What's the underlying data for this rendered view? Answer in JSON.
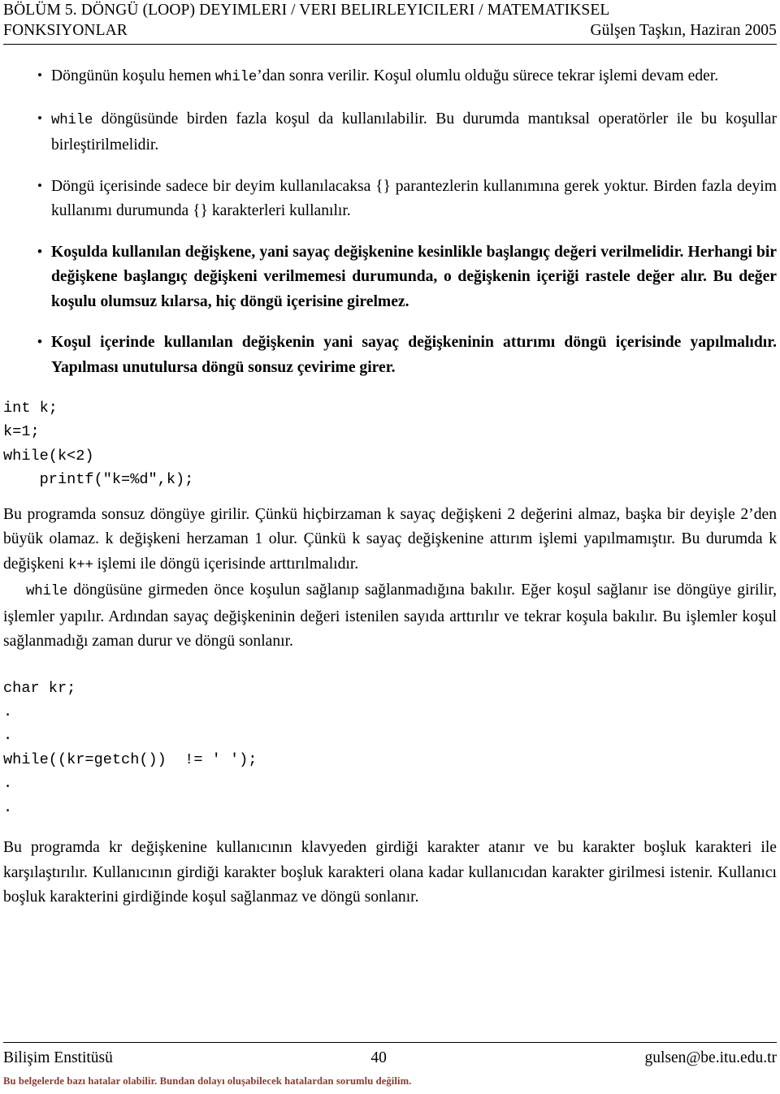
{
  "header": {
    "chapter_line1": "BÖLÜM 5.  DÖNGÜ (LOOP) DEYIMLERI / VERI BELIRLEYICILERI / MATEMATIKSEL",
    "chapter_line2": "FONKSIYONLAR",
    "author_date": "Gülşen Taşkın, Haziran 2005"
  },
  "bullets": [
    {
      "bold": false,
      "parts": [
        {
          "type": "text",
          "value": "Döngünün koşulu hemen "
        },
        {
          "type": "code",
          "value": "while"
        },
        {
          "type": "text",
          "value": "’dan sonra verilir. Koşul olumlu olduğu sürece tekrar işlemi devam eder."
        }
      ]
    },
    {
      "bold": false,
      "parts": [
        {
          "type": "code",
          "value": "while"
        },
        {
          "type": "text",
          "value": " döngüsünde birden fazla koşul da kullanılabilir. Bu durumda mantıksal operatörler ile bu koşullar birleştirilmelidir."
        }
      ]
    },
    {
      "bold": false,
      "parts": [
        {
          "type": "text",
          "value": "Döngü içerisinde sadece bir deyim kullanılacaksa {} parantezlerin kullanımına gerek yoktur. Birden fazla deyim kullanımı durumunda {} karakterleri kullanılır."
        }
      ]
    },
    {
      "bold": true,
      "parts": [
        {
          "type": "text",
          "value": "Koşulda kullanılan değişkene, yani sayaç değişkenine kesinlikle başlangıç değeri verilmelidir. Herhangi bir değişkene başlangıç değişkeni verilmemesi durumunda, o değişkenin içeriği rastele değer alır. Bu değer koşulu olumsuz kılarsa, hiç döngü içerisine girelmez."
        }
      ]
    },
    {
      "bold": true,
      "parts": [
        {
          "type": "text",
          "value": "Koşul içerinde kullanılan değişkenin yani sayaç değişkeninin attırımı döngü içerisinde yapılmalıdır. Yapılması unutulursa döngü sonsuz çevirime girer."
        }
      ]
    }
  ],
  "code_block_1": "int k;\nk=1;\nwhile(k<2)\n    printf(\"k=%d\",k);",
  "paragraph_1": {
    "parts": [
      {
        "type": "text",
        "value": "Bu programda sonsuz döngüye girilir. Çünkü hiçbirzaman k sayaç değişkeni 2 değerini almaz, başka bir deyişle 2’den büyük olamaz. k değişkeni herzaman 1 olur. Çünkü k sayaç değişkenine attırım işlemi yapılmamıştır. Bu durumda k değişkeni "
      },
      {
        "type": "code",
        "value": "k++"
      },
      {
        "type": "text",
        "value": " işlemi ile döngü içerisinde arttırılmalıdır."
      }
    ]
  },
  "paragraph_2": {
    "parts": [
      {
        "type": "code",
        "value": "while"
      },
      {
        "type": "text",
        "value": " döngüsüne girmeden önce koşulun sağlanıp sağlanmadığına bakılır. Eğer koşul sağlanır ise döngüye girilir, işlemler yapılır. Ardından sayaç değişkeninin değeri istenilen sayıda arttırılır ve tekrar koşula bakılır. Bu işlemler koşul sağlanmadığı zaman durur ve döngü sonlanır."
      }
    ]
  },
  "code_block_2": "char kr;\n.\n.\nwhile((kr=getch())  != ' ');\n.\n.",
  "paragraph_3": {
    "parts": [
      {
        "type": "text",
        "value": "Bu programda kr değişkenine kullanıcının klavyeden girdiği karakter atanır ve bu karakter boşluk karakteri ile karşılaştırılır. Kullanıcının girdiği karakter boşluk karakteri olana kadar kullanıcıdan karakter girilmesi istenir. Kullanıcı boşluk karakterini girdiğinde koşul sağlanmaz ve döngü sonlanır."
      }
    ]
  },
  "footer": {
    "institute": "Bilişim Enstitüsü",
    "page_number": "40",
    "email": "gulsen@be.itu.edu.tr",
    "disclaimer": "Bu belgelerde bazı hatalar olabilir. Bundan dolayı oluşabilecek hatalardan sorumlu değilim.",
    "disclaimer_color": "#8a3a2d"
  }
}
